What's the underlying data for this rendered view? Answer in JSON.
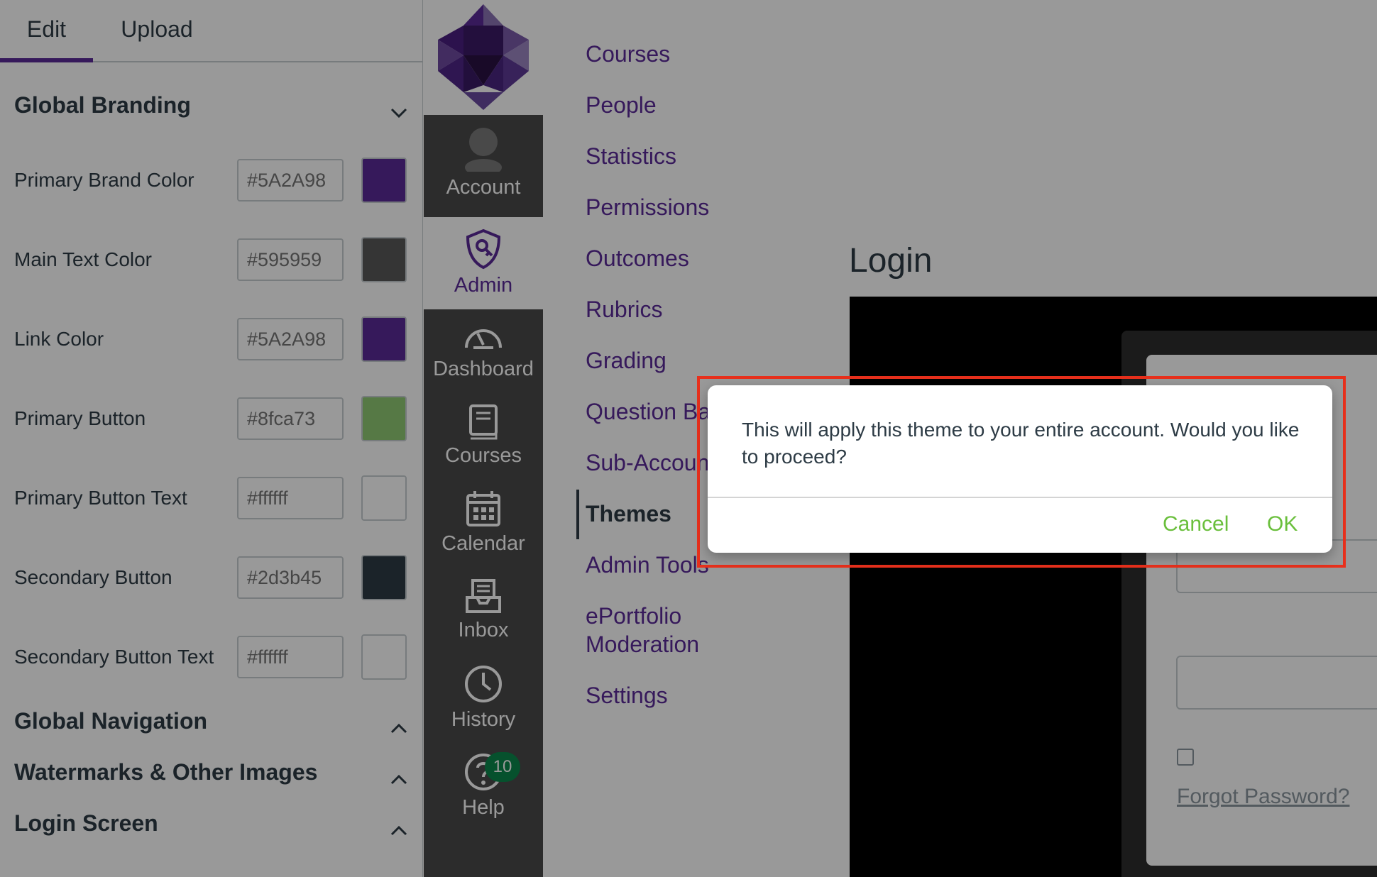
{
  "editor": {
    "tabs": [
      {
        "label": "Edit"
      },
      {
        "label": "Upload"
      }
    ],
    "global_branding": {
      "title": "Global Branding",
      "rows": [
        {
          "label": "Primary Brand Color",
          "value": "#5A2A98",
          "swatch": "#5a2a98"
        },
        {
          "label": "Main Text Color",
          "value": "#595959",
          "swatch": "#595959"
        },
        {
          "label": "Link Color",
          "value": "#5A2A98",
          "swatch": "#5a2a98"
        },
        {
          "label": "Primary Button",
          "value": "#8fca73",
          "swatch": "#8fca73"
        },
        {
          "label": "Primary Button Text",
          "value": "#ffffff",
          "swatch": "#ffffff"
        },
        {
          "label": "Secondary Button",
          "value": "#2d3b45",
          "swatch": "#2d3b45"
        },
        {
          "label": "Secondary Button Text",
          "value": "#ffffff",
          "swatch": "#ffffff"
        }
      ]
    },
    "sections": [
      {
        "title": "Global Navigation"
      },
      {
        "title": "Watermarks & Other Images"
      },
      {
        "title": "Login Screen"
      }
    ]
  },
  "global_nav": {
    "items": [
      {
        "label": "Account",
        "icon": "user-avatar-icon"
      },
      {
        "label": "Admin",
        "icon": "shield-key-icon"
      },
      {
        "label": "Dashboard",
        "icon": "speedometer-icon"
      },
      {
        "label": "Courses",
        "icon": "book-icon"
      },
      {
        "label": "Calendar",
        "icon": "calendar-icon"
      },
      {
        "label": "Inbox",
        "icon": "inbox-icon"
      },
      {
        "label": "History",
        "icon": "clock-icon"
      },
      {
        "label": "Help",
        "icon": "help-icon",
        "badge": "10"
      }
    ]
  },
  "admin_nav": {
    "items": [
      {
        "label": "Courses"
      },
      {
        "label": "People"
      },
      {
        "label": "Statistics"
      },
      {
        "label": "Permissions"
      },
      {
        "label": "Outcomes"
      },
      {
        "label": "Rubrics"
      },
      {
        "label": "Grading"
      },
      {
        "label": "Question Ba"
      },
      {
        "label": "Sub-Account"
      },
      {
        "label": "Themes"
      },
      {
        "label": "Admin Tools"
      },
      {
        "label": "ePortfolio Moderation"
      },
      {
        "label": "Settings"
      }
    ],
    "active": "Themes"
  },
  "preview": {
    "title": "Login",
    "forgot_password": "Forgot Password?"
  },
  "dialog": {
    "message": "This will apply this theme to your entire account. Would you like to proceed?",
    "cancel_label": "Cancel",
    "ok_label": "OK"
  },
  "colors": {
    "brand": "#5a2a98",
    "ok_button": "#6abf3c",
    "highlight_border": "#e8301c",
    "badge": "#0b874b"
  }
}
